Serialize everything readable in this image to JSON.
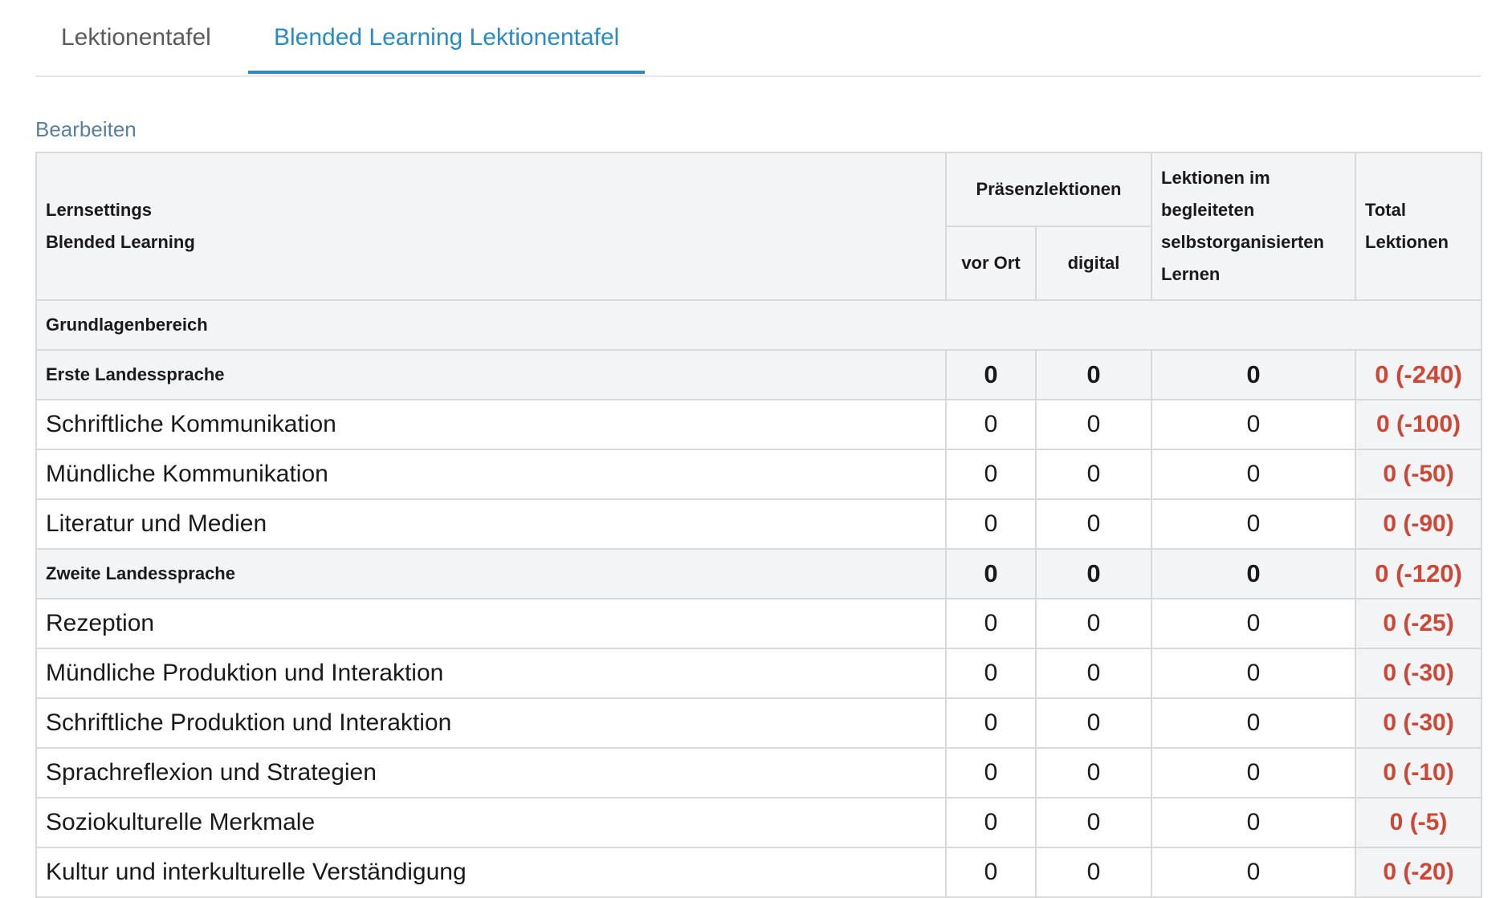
{
  "colors": {
    "accent": "#2a8bc4",
    "link": "#58809c",
    "negative": "#cc4736",
    "header_bg": "#f3f4f6"
  },
  "tabs": [
    {
      "label": "Lektionentafel",
      "active": false
    },
    {
      "label": "Blended Learning Lektionentafel",
      "active": true
    }
  ],
  "edit_label": "Bearbeiten",
  "table": {
    "header": {
      "col1_line1": "Lernsettings",
      "col1_line2": "Blended Learning",
      "praesenz": "Präsenzlektionen",
      "vor_ort": "vor Ort",
      "digital": "digital",
      "begleitet_l1": "Lektionen im",
      "begleitet_l2": "begleiteten",
      "begleitet_l3": "selbstorganisierten",
      "begleitet_l4": "Lernen",
      "total_l1": "Total",
      "total_l2": "Lektionen"
    },
    "section": "Grundlagenbereich",
    "rows": [
      {
        "kind": "grp",
        "name": "Erste Landessprache",
        "vor_ort": "0",
        "digital": "0",
        "begleitet": "0",
        "total": "0 (-240)"
      },
      {
        "kind": "item",
        "name": "Schriftliche Kommunikation",
        "vor_ort": "0",
        "digital": "0",
        "begleitet": "0",
        "total": "0 (-100)"
      },
      {
        "kind": "item",
        "name": "Mündliche Kommunikation",
        "vor_ort": "0",
        "digital": "0",
        "begleitet": "0",
        "total": "0 (-50)"
      },
      {
        "kind": "item",
        "name": "Literatur und Medien",
        "vor_ort": "0",
        "digital": "0",
        "begleitet": "0",
        "total": "0 (-90)"
      },
      {
        "kind": "grp",
        "name": "Zweite Landessprache",
        "vor_ort": "0",
        "digital": "0",
        "begleitet": "0",
        "total": "0 (-120)"
      },
      {
        "kind": "item",
        "name": "Rezeption",
        "vor_ort": "0",
        "digital": "0",
        "begleitet": "0",
        "total": "0 (-25)"
      },
      {
        "kind": "item",
        "name": "Mündliche Produktion und Interaktion",
        "vor_ort": "0",
        "digital": "0",
        "begleitet": "0",
        "total": "0 (-30)"
      },
      {
        "kind": "item",
        "name": "Schriftliche Produktion und Interaktion",
        "vor_ort": "0",
        "digital": "0",
        "begleitet": "0",
        "total": "0 (-30)"
      },
      {
        "kind": "item",
        "name": "Sprachreflexion und Strategien",
        "vor_ort": "0",
        "digital": "0",
        "begleitet": "0",
        "total": "0 (-10)"
      },
      {
        "kind": "item",
        "name": "Soziokulturelle Merkmale",
        "vor_ort": "0",
        "digital": "0",
        "begleitet": "0",
        "total": "0 (-5)"
      },
      {
        "kind": "item",
        "name": "Kultur und interkulturelle Verständigung",
        "vor_ort": "0",
        "digital": "0",
        "begleitet": "0",
        "total": "0 (-20)"
      }
    ]
  }
}
